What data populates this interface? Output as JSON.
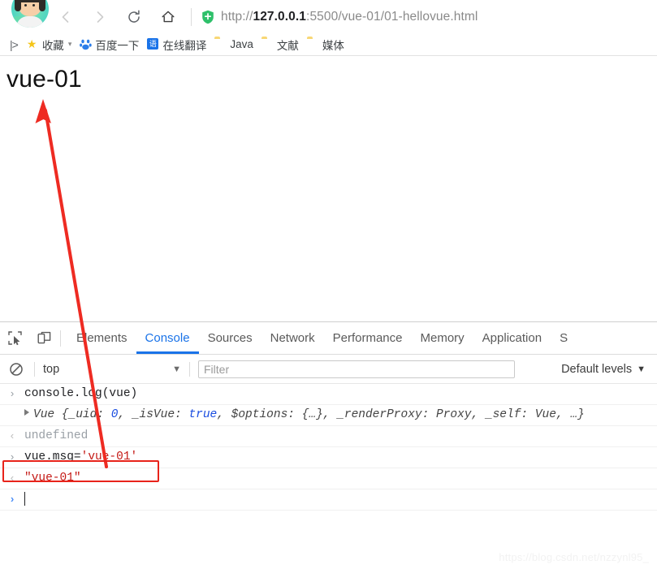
{
  "browser": {
    "nav": {
      "back_icon": "back-arrow-icon",
      "forward_icon": "forward-arrow-icon",
      "reload_icon": "reload-icon",
      "home_icon": "home-icon"
    },
    "omnibox": {
      "security_icon": "shield-icon",
      "url_scheme": "http://",
      "url_host": "127.0.0.1",
      "url_rest": ":5500/vue-01/01-hellovue.html",
      "full_url": "http://127.0.0.1:5500/vue-01/01-hellovue.html"
    },
    "bookmarks": {
      "overflow_label": "|>",
      "items": [
        {
          "label": "收藏",
          "icon": "star-icon",
          "has_caret": true
        },
        {
          "label": "百度一下",
          "icon": "baidu-icon",
          "has_caret": false
        },
        {
          "label": "在线翻译",
          "icon": "translate-icon",
          "has_caret": false
        },
        {
          "label": "Java",
          "icon": "folder-icon",
          "has_caret": false
        },
        {
          "label": "文献",
          "icon": "folder-icon",
          "has_caret": false
        },
        {
          "label": "媒体",
          "icon": "folder-icon",
          "has_caret": false
        }
      ]
    }
  },
  "page": {
    "heading": "vue-01"
  },
  "annotation": {
    "arrow_color": "#ee2b22",
    "box_color": "#e8231a"
  },
  "devtools": {
    "inspect_icon": "inspect-element-icon",
    "device_icon": "device-toolbar-icon",
    "tabs": [
      {
        "label": "Elements",
        "active": false
      },
      {
        "label": "Console",
        "active": true
      },
      {
        "label": "Sources",
        "active": false
      },
      {
        "label": "Network",
        "active": false
      },
      {
        "label": "Performance",
        "active": false
      },
      {
        "label": "Memory",
        "active": false
      },
      {
        "label": "Application",
        "active": false
      },
      {
        "label": "S",
        "active": false
      }
    ],
    "filterbar": {
      "clear_icon": "clear-console-icon",
      "context": "top",
      "context_caret": "▼",
      "filter_placeholder": "Filter",
      "filter_value": "",
      "levels_label": "Default levels",
      "levels_caret": "▼"
    },
    "console_rows": [
      {
        "kind": "input",
        "gutter": "›",
        "text": "console.log(vue)"
      },
      {
        "kind": "object",
        "gutter": "",
        "expander": "▶",
        "prefix": "Vue ",
        "body": "{_uid: 0, _isVue: true, $options: {…}, _renderProxy: Proxy, _self: Vue, …}",
        "tokens": [
          {
            "t": "Vue ",
            "c": "plain"
          },
          {
            "t": "{",
            "c": "plain"
          },
          {
            "t": "_uid",
            "c": "plain"
          },
          {
            "t": ": ",
            "c": "plain"
          },
          {
            "t": "0",
            "c": "kw"
          },
          {
            "t": ", ",
            "c": "plain"
          },
          {
            "t": "_isVue",
            "c": "plain"
          },
          {
            "t": ": ",
            "c": "plain"
          },
          {
            "t": "true",
            "c": "kw"
          },
          {
            "t": ", ",
            "c": "plain"
          },
          {
            "t": "$options",
            "c": "plain"
          },
          {
            "t": ": {…}, ",
            "c": "plain"
          },
          {
            "t": "_renderProxy",
            "c": "plain"
          },
          {
            "t": ": Proxy, ",
            "c": "plain"
          },
          {
            "t": "_self",
            "c": "plain"
          },
          {
            "t": ": Vue, …}",
            "c": "plain"
          }
        ]
      },
      {
        "kind": "output-dim",
        "gutter": "‹",
        "text": "undefined"
      },
      {
        "kind": "input-highlighted",
        "gutter": "›",
        "code_plain": "vue.msg=",
        "code_string": "'vue-01'"
      },
      {
        "kind": "output-string",
        "gutter": "‹",
        "text": "\"vue-01\""
      },
      {
        "kind": "prompt",
        "gutter": "›",
        "text": ""
      }
    ]
  },
  "watermark": {
    "text": "https://blog.csdn.net/nzzynl95_"
  }
}
